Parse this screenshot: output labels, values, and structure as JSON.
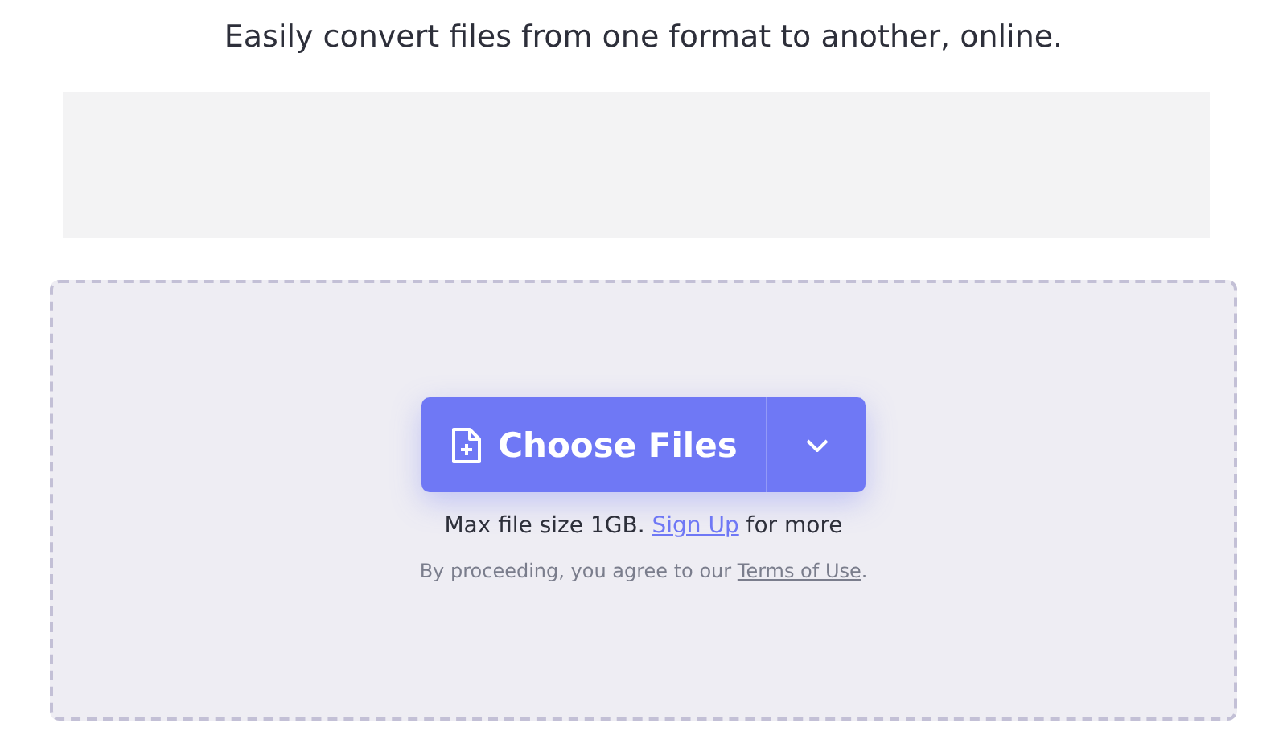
{
  "tagline": "Easily convert files from one format to another, online.",
  "upload": {
    "button": "Choose Files",
    "limit": {
      "before": "Max file size 1GB. ",
      "link": "Sign Up",
      "after": " for more"
    },
    "terms": {
      "before": "By proceeding, you agree to our ",
      "link": "Terms of Use",
      "after": "."
    }
  }
}
